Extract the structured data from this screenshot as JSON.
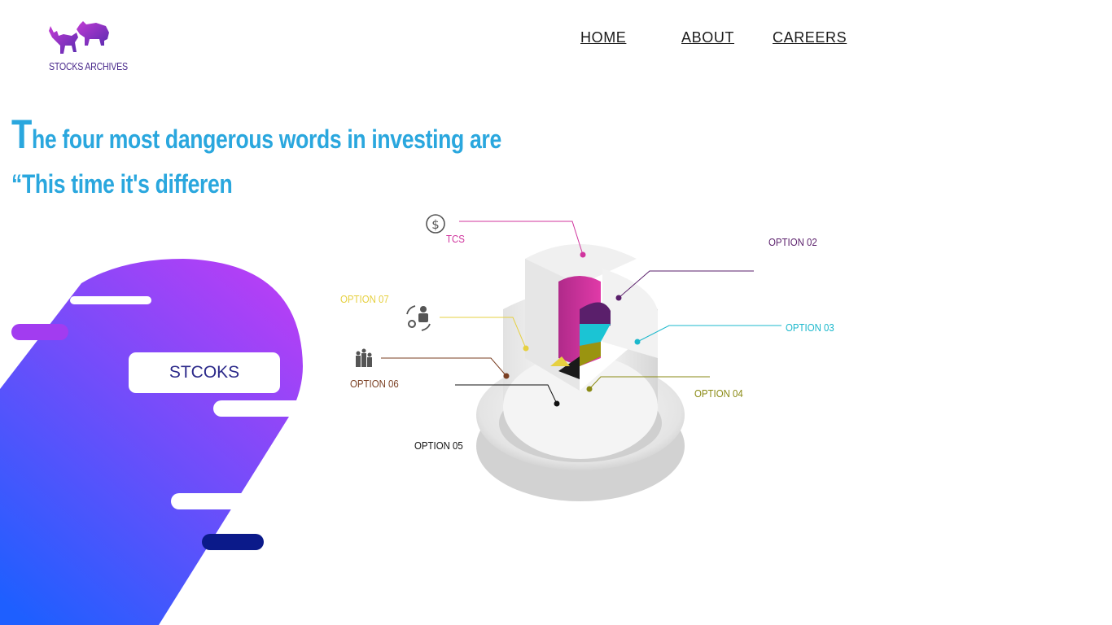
{
  "brand": {
    "logo_text": "STOCKS ARCHIVES",
    "icon": "bull-bear-icon"
  },
  "nav": {
    "items": [
      {
        "label": "HOME"
      },
      {
        "label": "ABOUT"
      },
      {
        "label": "CAREERS"
      }
    ]
  },
  "hero": {
    "headline_first_letter": "T",
    "headline_rest": "he four most dangerous words in investing are",
    "quote": "“This time it's differen",
    "button_label": "STCOKS"
  },
  "infographic": {
    "options": [
      {
        "label": "TCS",
        "color": "#d0359e",
        "icon": "dollar-icon"
      },
      {
        "label": "OPTION 02",
        "color": "#5a1f6b"
      },
      {
        "label": "OPTION 03",
        "color": "#1bb8cc"
      },
      {
        "label": "OPTION 04",
        "color": "#8a8a14"
      },
      {
        "label": "OPTION 05",
        "color": "#111111"
      },
      {
        "label": "OPTION 06",
        "color": "#7a3f22",
        "icon": "people-group-icon"
      },
      {
        "label": "OPTION 07",
        "color": "#e6d040",
        "icon": "businessman-gear-icon"
      }
    ]
  },
  "colors": {
    "headline": "#2aa7de",
    "gradient_top": "#b040f5",
    "gradient_bottom": "#1f60ff",
    "navy": "#0b1a8a"
  }
}
